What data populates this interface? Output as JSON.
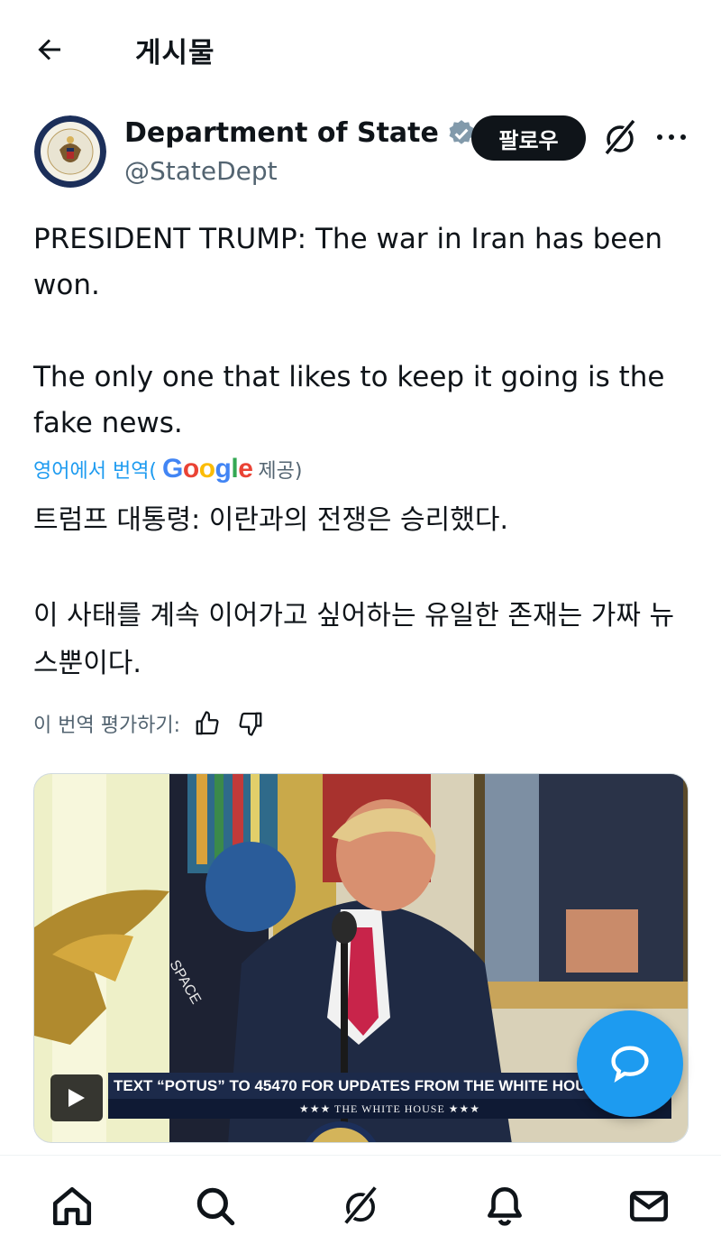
{
  "header": {
    "title": "게시물",
    "back_icon": "arrow-left-icon"
  },
  "author": {
    "name": "Department of State",
    "handle": "@StateDept",
    "verified_color": "#829aab",
    "follow_label": "팔로우"
  },
  "post": {
    "text": "PRESIDENT TRUMP: The war in Iran has been won.\n\nThe only one that likes to keep it going is the fake news.",
    "translate_prefix": "영어에서 번역(",
    "translate_brand": "Google",
    "translate_suffix": " 제공)",
    "translated_text": "트럼프 대통령: 이란과의 전쟁은 승리했다.\n\n이 사태를 계속 이어가고 싶어하는 유일한 존재는 가짜 뉴스뿐이다.",
    "rate_label": "이 번역 평가하기:"
  },
  "media": {
    "chyron": "TEXT “POTUS” TO 45470 FOR UPDATES FROM THE WHITE HOUSE",
    "chyron_sub": "★★★   THE WHITE HOUSE   ★★★",
    "banner_text": "SPACE"
  },
  "nav": {
    "items": [
      "home-icon",
      "search-icon",
      "grok-icon",
      "notifications-icon",
      "messages-icon"
    ]
  },
  "colors": {
    "accent": "#1d9bf0",
    "text": "#0f1419",
    "secondary": "#536471"
  }
}
